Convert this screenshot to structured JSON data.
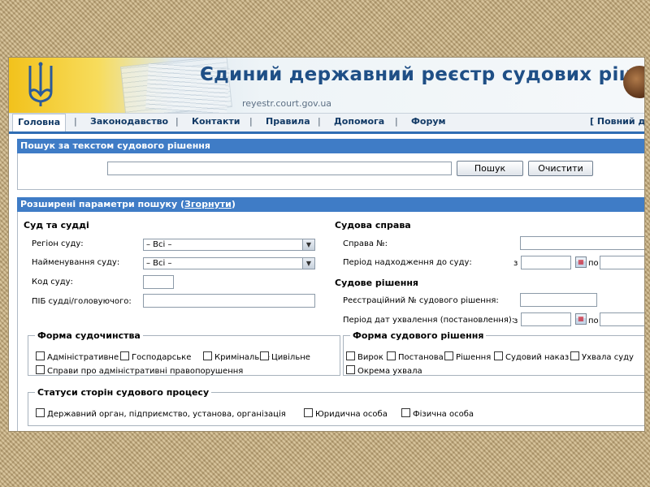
{
  "header": {
    "title": "Єдиний державний реєстр судових рішень",
    "url": "reyestr.court.gov.ua"
  },
  "nav": {
    "items": [
      "Головна",
      "Законодавство",
      "Контакти",
      "Правила",
      "Допомога",
      "Форум"
    ],
    "right": "[ Повний до",
    "separator": "|"
  },
  "search": {
    "panel_title": "Пошук за текстом судового рішення",
    "input_value": "",
    "search_button": "Пошук",
    "clear_button": "Очистити"
  },
  "advanced": {
    "panel_title_prefix": "Розширені параметри пошуку (",
    "collapse_link": "Згорнути",
    "panel_title_suffix": ")",
    "court": {
      "section": "Суд та судді",
      "region_label": "Регіон суду:",
      "region_value": "– Всі –",
      "name_label": "Найменування суду:",
      "name_value": "– Всі –",
      "code_label": "Код суду:",
      "judge_label": "ПІБ судді/головуючого:"
    },
    "case": {
      "section": "Судова справа",
      "case_no_label": "Справа №:",
      "period_label": "Період надходження до суду:",
      "from": "з",
      "to": "по"
    },
    "decision": {
      "section": "Судове рішення",
      "reg_no_label": "Реєстраційний № судового рішення:",
      "period_label": "Період дат ухвалення (постановлення):",
      "from": "з",
      "to": "по"
    },
    "proceedings_form": {
      "legend": "Форма судочинства",
      "options": [
        "Адміністративне",
        "Господарське",
        "Кримінальне",
        "Цивільне",
        "Справи про адміністративні правопорушення"
      ]
    },
    "decision_form": {
      "legend": "Форма судового рішення",
      "options": [
        "Вирок",
        "Постанова",
        "Рішення",
        "Судовий наказ",
        "Ухвала суду",
        "Окрема ухвала"
      ]
    },
    "party_status": {
      "legend": "Статуси сторін судового процесу",
      "options": [
        "Державний орган, підприємство, установа, організація",
        "Юридична особа",
        "Фізична особа"
      ]
    }
  },
  "colors": {
    "panel_header": "#3f7cc6",
    "title_text": "#1f4f86",
    "nav_underline": "#2f6db3"
  }
}
